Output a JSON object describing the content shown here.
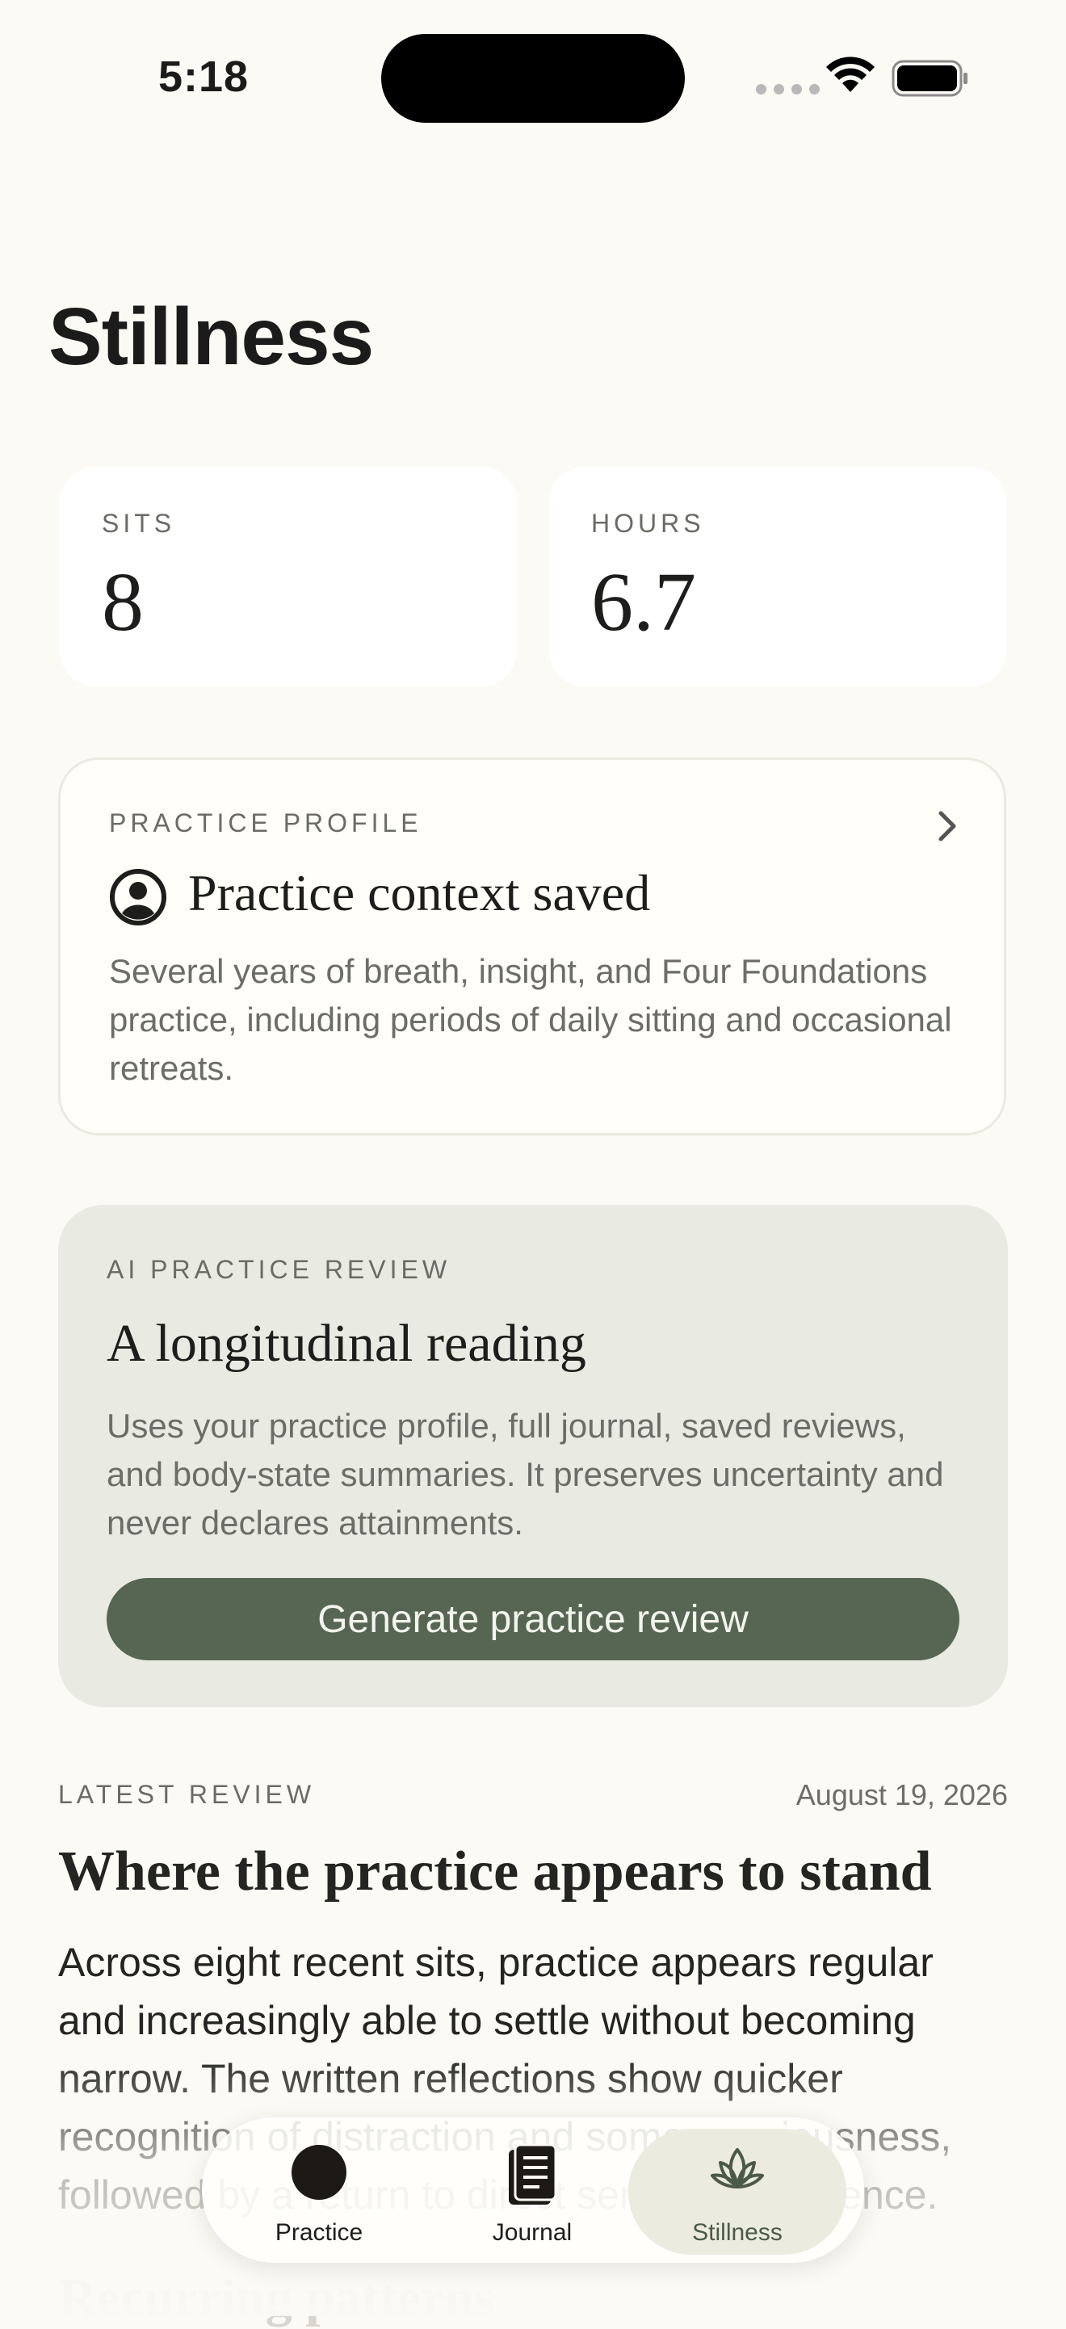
{
  "status_bar": {
    "time": "5:18"
  },
  "page": {
    "title": "Stillness"
  },
  "stats": [
    {
      "label": "SITS",
      "value": "8"
    },
    {
      "label": "HOURS",
      "value": "6.7"
    }
  ],
  "profile": {
    "eyebrow": "PRACTICE PROFILE",
    "heading": "Practice context saved",
    "body": "Several years of breath, insight, and Four Foundations practice, including periods of daily sitting and occasional retreats."
  },
  "ai_review": {
    "eyebrow": "AI PRACTICE REVIEW",
    "heading": "A longitudinal reading",
    "body": "Uses your practice profile, full journal, saved reviews, and body-state summaries. It preserves uncertainty and never declares attainments.",
    "button_label": "Generate practice review"
  },
  "latest_review": {
    "label": "LATEST REVIEW",
    "date": "August 19, 2026",
    "heading": "Where the practice appears to stand",
    "body": "Across eight recent sits, practice appears regular and increasingly able to settle without becoming narrow. The written reflections show quicker recognition of distraction and some spaciousness, followed by a return to direct sensory experience.",
    "next_heading": "Recurring patterns"
  },
  "tabs": [
    {
      "label": "Practice",
      "icon": "circle-icon"
    },
    {
      "label": "Journal",
      "icon": "book-icon"
    },
    {
      "label": "Stillness",
      "icon": "lotus-icon",
      "selected": true
    }
  ],
  "colors": {
    "background": "#fcfaf4",
    "accent": "#566652",
    "review_card": "#e9ebe3"
  }
}
